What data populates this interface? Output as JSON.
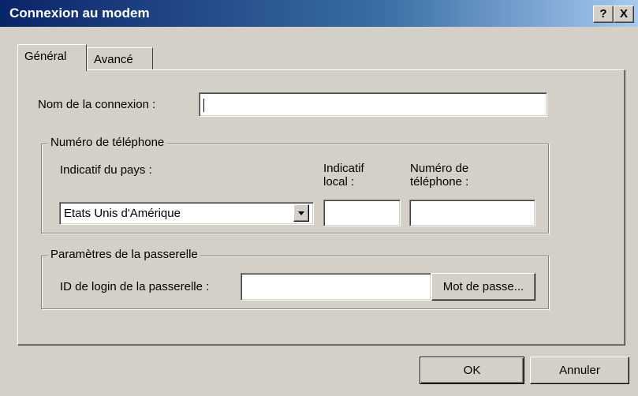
{
  "window": {
    "title": "Connexion au modem",
    "help_label": "?",
    "close_label": "X"
  },
  "tabs": [
    {
      "label": "Général"
    },
    {
      "label": "Avancé"
    }
  ],
  "connection": {
    "name_label": "Nom de la connexion :",
    "name_value": ""
  },
  "phone_group": {
    "legend": "Numéro de téléphone",
    "country_label": "Indicatif du pays :",
    "country_value": "Etats Unis d'Amérique",
    "local_code_label_1": "Indicatif",
    "local_code_label_2": "local :",
    "local_code_value": "",
    "phone_label_1": "Numéro de",
    "phone_label_2": "téléphone :",
    "phone_value": ""
  },
  "gateway_group": {
    "legend": "Paramètres de la passerelle",
    "login_label": "ID de login de la passerelle :",
    "login_value": "",
    "password_button": "Mot de passe..."
  },
  "buttons": {
    "ok": "OK",
    "cancel": "Annuler"
  },
  "colors": {
    "dialog_bg": "#d4d0c8",
    "titlebar_start": "#0a246a",
    "titlebar_end": "#a6caf0"
  }
}
